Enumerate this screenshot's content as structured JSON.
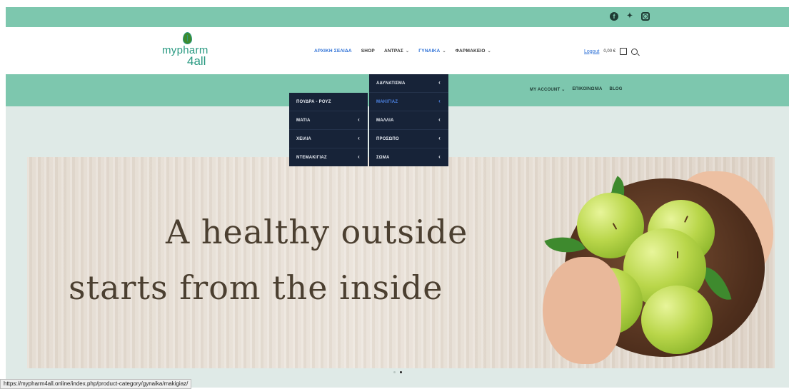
{
  "social": {
    "icons": [
      "facebook-icon",
      "twitter-icon",
      "instagram-icon"
    ]
  },
  "logo": {
    "name": "mypharm",
    "suffix": "4all"
  },
  "nav": {
    "items": [
      {
        "label": "ΑΡΧΙΚΗ ΣΕΛΙΔΑ",
        "dropdown": false,
        "active": true
      },
      {
        "label": "SHOP",
        "dropdown": false,
        "active": false
      },
      {
        "label": "ΑΝΤΡΑΣ",
        "dropdown": true,
        "active": false
      },
      {
        "label": "ΓΥΝΑΙΚΑ",
        "dropdown": true,
        "active": true
      },
      {
        "label": "ΦΑΡΜΑΚΕΙΟ",
        "dropdown": true,
        "active": false
      }
    ],
    "chevron": "⌄"
  },
  "account": {
    "logout": "Logout",
    "cart_total": "0,00 €"
  },
  "secondary_nav": {
    "my_account": "MY ACCOUNT",
    "contact": "ΕΠΙΚΟΙΝΩΝΙΑ",
    "blog": "BLOG"
  },
  "menu_level1": [
    {
      "label": "ΑΔΥΝΑΤΙΣΜΑ",
      "has_sub": true,
      "active": false
    },
    {
      "label": "ΜΑΚΙΓΙΑΖ",
      "has_sub": true,
      "active": true
    },
    {
      "label": "ΜΑΛΛΙΑ",
      "has_sub": true,
      "active": false
    },
    {
      "label": "ΠΡΟΣΩΠΟ",
      "has_sub": true,
      "active": false
    },
    {
      "label": "ΣΩΜΑ",
      "has_sub": true,
      "active": false
    }
  ],
  "menu_level2": [
    {
      "label": "ΠΟΥΔΡΑ - ΡΟΥΖ",
      "has_sub": false
    },
    {
      "label": "ΜΑΤΙΑ",
      "has_sub": true
    },
    {
      "label": "ΧΕΙΛΙΑ",
      "has_sub": true
    },
    {
      "label": "ΝΤΕΜΑΚΙΓΙΑΖ",
      "has_sub": true
    }
  ],
  "hero": {
    "line1": "A healthy outside",
    "line2": "starts from the inside"
  },
  "slider": {
    "dots": 2,
    "active_index": 1
  },
  "status_url": "https://mypharm4all.online/index.php/product-category/gynaika/makigiaz/",
  "colors": {
    "brand_green": "#7dc7ae",
    "menu_bg": "#172338",
    "link_blue": "#2b6fd6"
  }
}
